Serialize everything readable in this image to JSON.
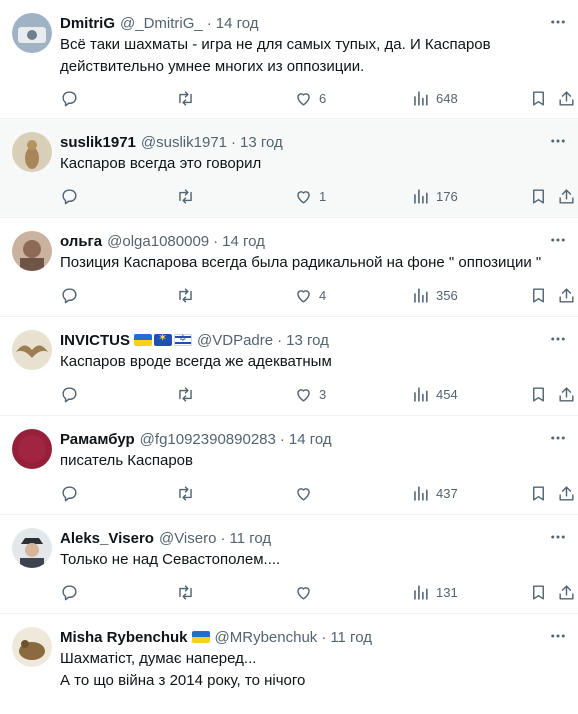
{
  "tweets": [
    {
      "name": "DmitriG",
      "handle": "@_DmitriG_",
      "sep": "·",
      "time": "14 год",
      "text": "Всё таки шахматы - игра не для самых тупых, да. И Каспаров действительно умнее многих из оппозиции.",
      "likes": "6",
      "views": "648",
      "avatar_color": "#8fa6b8"
    },
    {
      "name": "suslik1971",
      "handle": "@suslik1971",
      "sep": "·",
      "time": "13 год",
      "text": "Каспаров всегда это говорил",
      "likes": "1",
      "views": "176",
      "avatar_color": "#c7b08a"
    },
    {
      "name": "ольга",
      "handle": "@olga1080009",
      "sep": "·",
      "time": "14 год",
      "text": "Позиция Каспарова всегда была радикальной на фоне  \" оппозиции \"",
      "likes": "4",
      "views": "356",
      "avatar_color": "#a78470"
    },
    {
      "name": "INVICTUS",
      "handle": "@VDPadre",
      "sep": "·",
      "time": "13 год",
      "text": "Каспаров вроде всегда же адекватным",
      "likes": "3",
      "views": "454",
      "avatar_color": "#b9a888"
    },
    {
      "name": "Рамамбур",
      "handle": "@fg1092390890283",
      "sep": "·",
      "time": "14 год",
      "text": "писатель Каспаров",
      "likes": "",
      "views": "437",
      "avatar_color": "#96203a"
    },
    {
      "name": "Aleks_Visero",
      "handle": "@Visero",
      "sep": "·",
      "time": "11 год",
      "text": "Только не над Севастополем....",
      "likes": "",
      "views": "131",
      "avatar_color": "#5a6472"
    },
    {
      "name": "Misha Rybenchuk",
      "handle": "@MRybenchuk",
      "sep": "·",
      "time": "11 год",
      "text": "Шахматіст, думає наперед...\nА то що війна з 2014 року, то нічого",
      "likes": "",
      "views": "",
      "avatar_color": "#d7cfbf"
    }
  ],
  "colors": {
    "text": "#0f1419",
    "secondary": "#536471",
    "border": "#eff3f4",
    "hover_bg": "#f7f9f9"
  },
  "icons": {
    "reply": "reply-icon",
    "retweet": "retweet-icon",
    "like": "like-icon",
    "views": "views-icon",
    "bookmark": "bookmark-icon",
    "share": "share-icon",
    "more": "more-icon"
  }
}
